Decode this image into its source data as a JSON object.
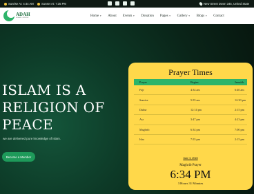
{
  "topbar": {
    "sunrise": "Sunrise At: 4:44 AM",
    "sunset": "Sunset At: 7:35 PM",
    "social": [
      "facebook-icon",
      "x-icon",
      "linkedin-icon",
      "instagram-icon"
    ],
    "address": "New Street Down 345, United State"
  },
  "brand": {
    "name": "ADAH",
    "tagline": "ISLAMIC CENTER",
    "color": "#2db46a"
  },
  "nav": {
    "items": [
      {
        "label": "Home",
        "has_dropdown": true
      },
      {
        "label": "About",
        "has_dropdown": false
      },
      {
        "label": "Events",
        "has_dropdown": true
      },
      {
        "label": "Donation",
        "has_dropdown": false
      },
      {
        "label": "Pages",
        "has_dropdown": true
      },
      {
        "label": "Gallery",
        "has_dropdown": true
      },
      {
        "label": "Blogs",
        "has_dropdown": true
      },
      {
        "label": "Contact",
        "has_dropdown": false
      }
    ]
  },
  "hero": {
    "title": "ISLAM IS A RELIGION OF PEACE",
    "subtitle": "we are delivered pure knowledge of islam.",
    "cta": "Become a Member"
  },
  "prayer": {
    "title": "Prayer Times",
    "columns": [
      "Prayer",
      "Begins",
      "Jama'ah"
    ],
    "rows": [
      {
        "name": "Fajr",
        "begins": "4:34 am",
        "jamaah": "6:40 am"
      },
      {
        "name": "Sunrise",
        "begins": "5:55 am",
        "jamaah": "12:30 pm"
      },
      {
        "name": "Duhur",
        "begins": "12:14 pm",
        "jamaah": "2:15 pm"
      },
      {
        "name": "Asr",
        "begins": "3:47 pm",
        "jamaah": "4:23 pm"
      },
      {
        "name": "Maghrib",
        "begins": "6:34 pm",
        "jamaah": "7:00 pm"
      },
      {
        "name": "Isha",
        "begins": "7:55 pm",
        "jamaah": "2:15 pm"
      }
    ],
    "date": "June 3, 2024",
    "next_name": "Maghrib Prayer",
    "next_time": "6:34 PM",
    "remaining": "3 Hours 31 Minutes"
  }
}
